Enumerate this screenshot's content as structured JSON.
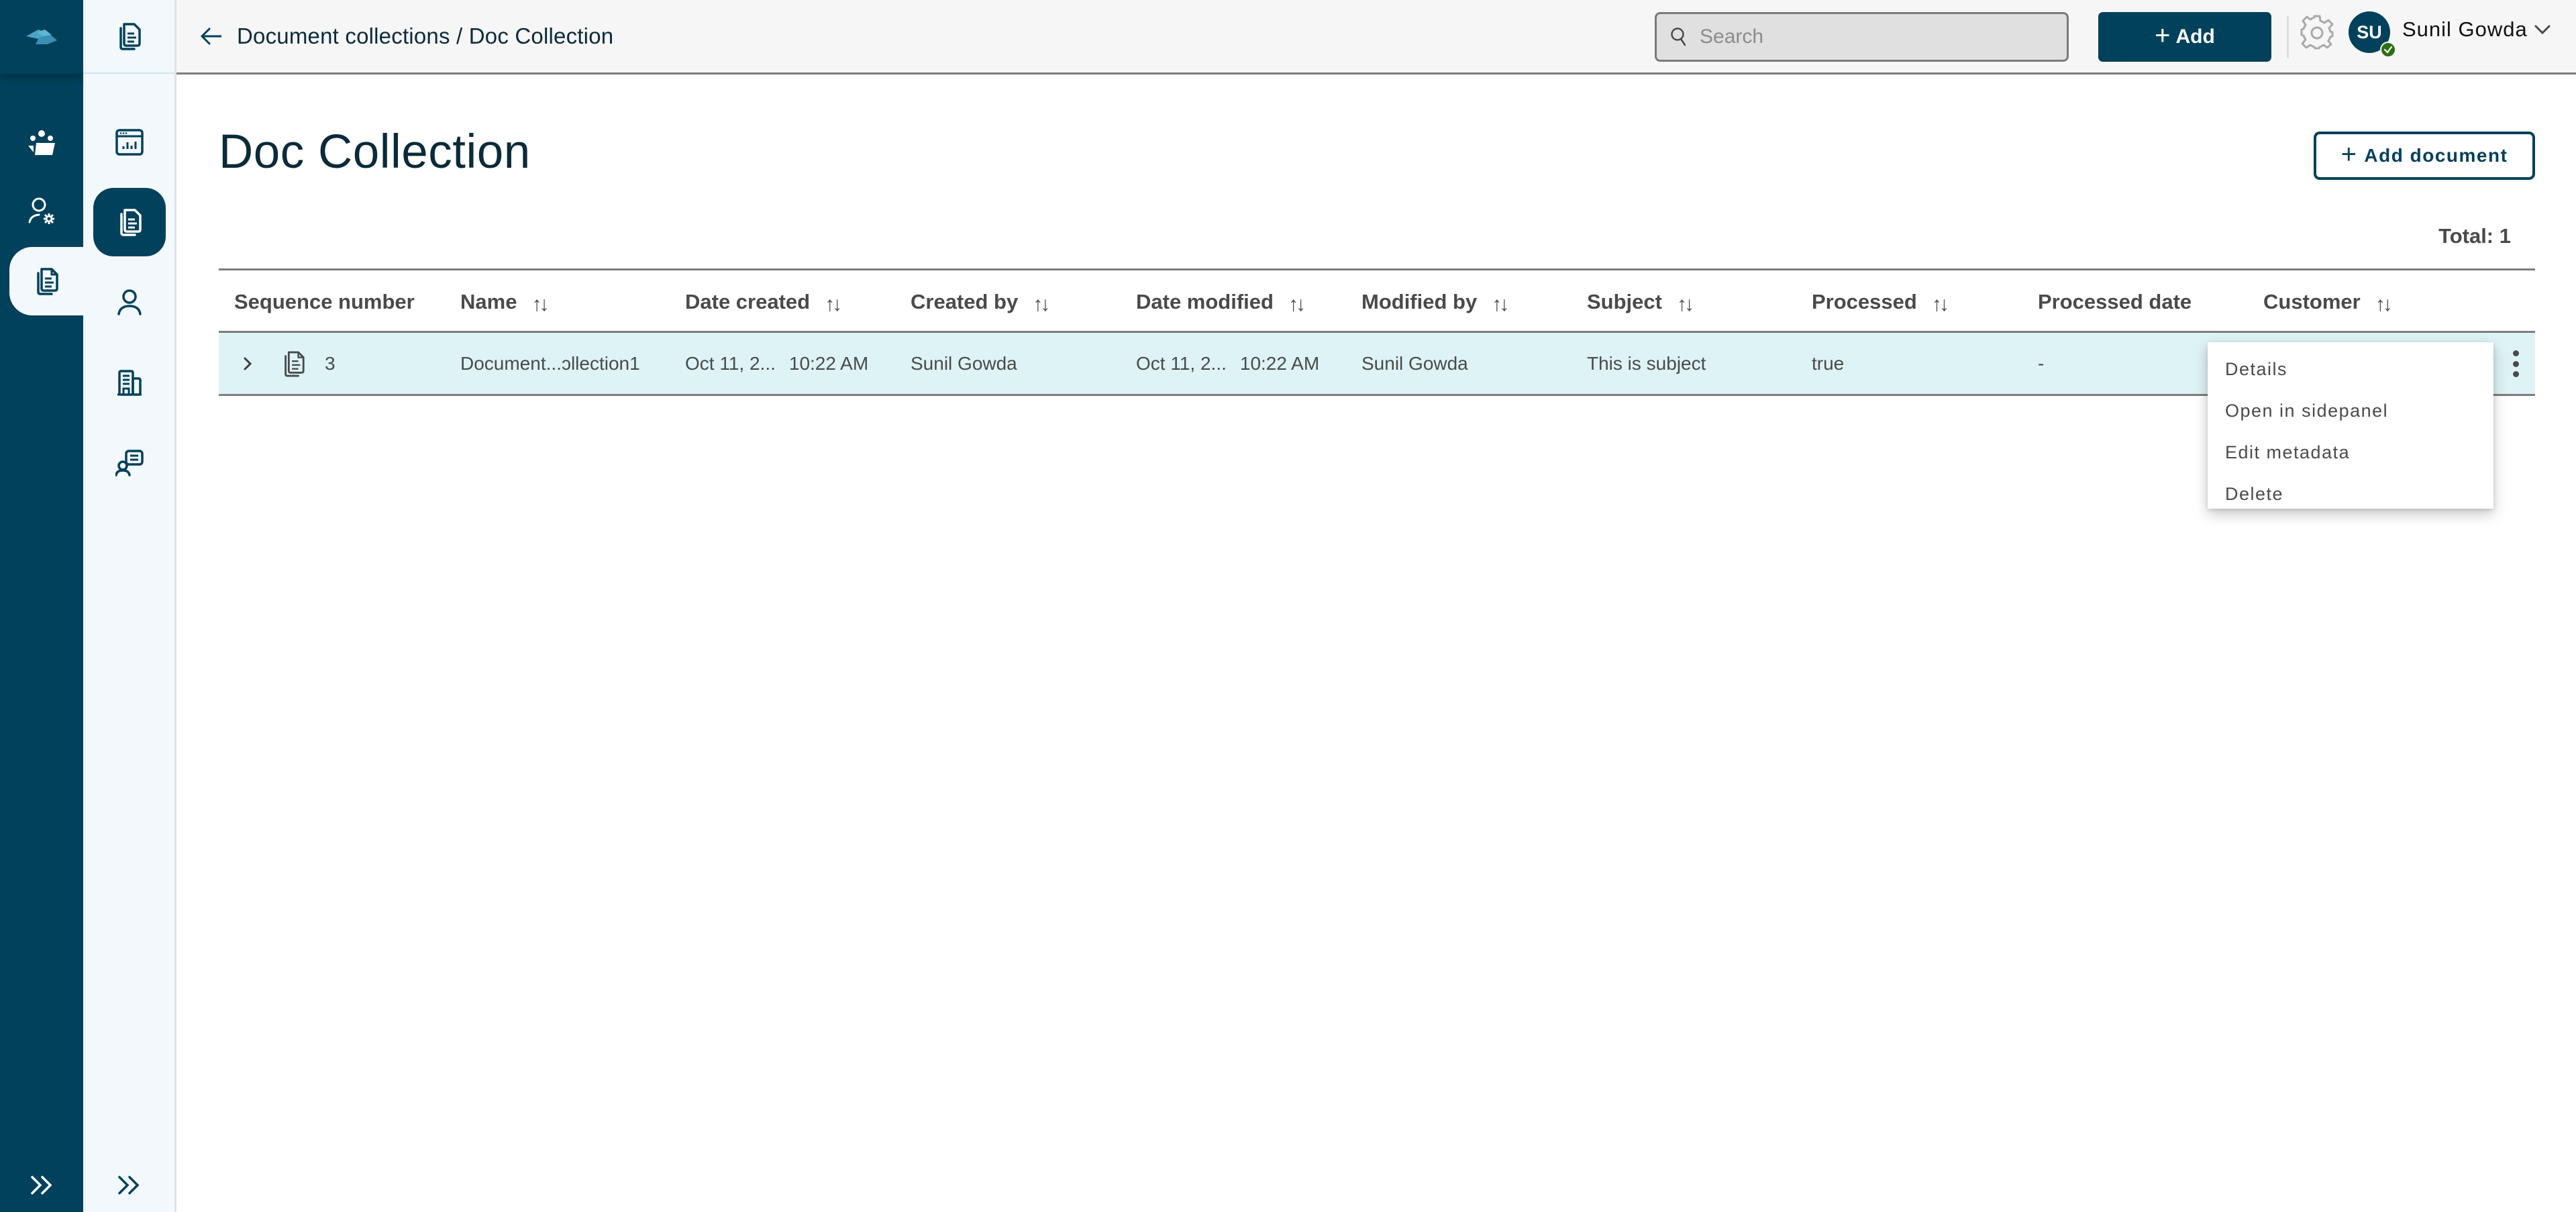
{
  "app": {
    "colors": {
      "primary": "#01415b",
      "rail_light": "#f3f8fc",
      "row_highlight": "#def3f6",
      "status_online": "#2e6f10"
    }
  },
  "rail_primary": {
    "logo_icon": "app-logo-icon",
    "items": [
      {
        "icon": "team-icon",
        "label": "Teams"
      },
      {
        "icon": "user-settings-icon",
        "label": "User settings"
      },
      {
        "icon": "documents-icon",
        "label": "Documents",
        "active": true
      }
    ],
    "expand_icon": "double-chevron-right-icon"
  },
  "rail_secondary": {
    "top_icon": "documents-icon",
    "items": [
      {
        "icon": "dashboard-icon",
        "label": "Dashboard"
      },
      {
        "icon": "documents-icon",
        "label": "Document collections",
        "active": true
      },
      {
        "icon": "user-icon",
        "label": "Users"
      },
      {
        "icon": "building-icon",
        "label": "Organizations"
      },
      {
        "icon": "contact-icon",
        "label": "Contacts"
      }
    ],
    "expand_icon": "double-chevron-right-icon"
  },
  "header": {
    "breadcrumb": "Document collections / Doc Collection",
    "search": {
      "placeholder": "Search",
      "value": ""
    },
    "add_label": "Add",
    "user": {
      "initials": "SU",
      "name": "Sunil Gowda",
      "status": "online"
    }
  },
  "page": {
    "title": "Doc Collection",
    "add_document_label": "Add document",
    "total": "Total: 1"
  },
  "table": {
    "columns": [
      {
        "label": "Sequence number",
        "sortable": false
      },
      {
        "label": "Name",
        "sortable": true
      },
      {
        "label": "Date created",
        "sortable": true
      },
      {
        "label": "Created by",
        "sortable": true
      },
      {
        "label": "Date modified",
        "sortable": true
      },
      {
        "label": "Modified by",
        "sortable": true
      },
      {
        "label": "Subject",
        "sortable": true
      },
      {
        "label": "Processed",
        "sortable": true
      },
      {
        "label": "Processed date",
        "sortable": false
      },
      {
        "label": "Customer",
        "sortable": true
      }
    ],
    "sort_glyph": "↑↓",
    "rows": [
      {
        "sequence": "3",
        "name": "Document...ɔllection1",
        "date_created": "Oct 11, 2...",
        "time_created": "10:22 AM",
        "created_by": "Sunil  Gowda",
        "date_modified": "Oct 11, 2...",
        "time_modified": "10:22 AM",
        "modified_by": "Sunil  Gowda",
        "subject": "This is subject",
        "processed": "true",
        "processed_date": "-",
        "customer": ""
      }
    ]
  },
  "context_menu": {
    "items": [
      "Details",
      "Open in sidepanel",
      "Edit metadata",
      "Delete"
    ]
  }
}
